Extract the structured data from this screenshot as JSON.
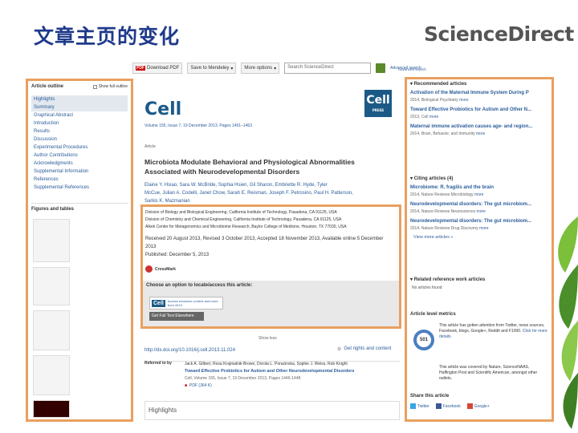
{
  "slide_title": "文章主页的变化",
  "brand": "ScienceDirect",
  "toolbar": {
    "download_pdf": "Download PDF",
    "mendeley": "Save to Mendeley",
    "more_options": "More options",
    "search_placeholder": "Search ScienceDirect",
    "advanced": "Advanced search"
  },
  "outline": {
    "heading": "Article outline",
    "show_full": "Show full outline",
    "items": [
      "Highlights",
      "Summary",
      "Graphical Abstract",
      "Introduction",
      "Results",
      "Discussion",
      "Experimental Procedures",
      "Author Contributions",
      "Acknowledgments",
      "Supplemental Information",
      "References",
      "Supplemental References"
    ],
    "figures_heading": "Figures and tables"
  },
  "article": {
    "journal": "Cell",
    "volume_line": "Volume 155, Issue 7, 19 December 2013, Pages 1451–1463",
    "type": "Article",
    "title": "Microbiota Modulate Behavioral and Physiological Abnormalities Associated with Neurodevelopmental Disorders",
    "authors_1": "Elaine Y. Hsiao, Sara W. McBride, Sophia Hsien, Gil Sharon, Embriette R. Hyde, Tyler",
    "authors_2": "McCue, Julian A. Codelli, Janet Chow, Sarah E. Reisman, Joseph F. Petrosino, Paul H. Patterson,",
    "authors_3": "Sarkis K. Mazmanian",
    "aff_1": "Division of Biology and Biological Engineering, California Institute of Technology, Pasadena, CA 91125, USA",
    "aff_2": "Division of Chemistry and Chemical Engineering, California Institute of Technology, Pasadena, CA 91125, USA",
    "aff_3": "Alkek Center for Metagenomics and Microbiome Research, Baylor College of Medicine, Houston, TX 77030, USA",
    "received": "Received 20 August 2013, Revised 3 October 2013, Accepted 18 November 2013, Available online 5 December 2013",
    "published": "Published: December 5, 2013",
    "crossmark": "CrossMark",
    "access_heading": "Choose an option to locate/access this article:",
    "access_btn": "Get Full Text Elsewhere",
    "access_promo": "Access exclusive content and more from 2013",
    "show_less": "Show less",
    "doi": "http://dx.doi.org/10.1016/j.cell.2013.11.024",
    "rights": "Get rights and content",
    "refereed_label": "Referred to by",
    "refereed_authors": "Jack A. Gilbert, Rosa Krajmalnik-Brown, Dorota L. Porazinska, Sophie J. Weiss, Rob Knight",
    "refereed_title": "Toward Effective Probiotics for Autism and Other Neurodevelopmental Disorders",
    "refereed_meta": "Cell, Volume 155, Issue 7, 19 December 2013, Pages 1446-1448",
    "refereed_pdf": "PDF (364 K)",
    "highlights": "Highlights"
  },
  "sidebar": {
    "recommended_heading": "Recommended articles",
    "recommended": [
      {
        "title": "Activation of the Maternal Immune System During P",
        "meta": "2014, Biological Psychiatry"
      },
      {
        "title": "Toward Effective Probiotics for Autism and Other N...",
        "meta": "2013, Cell"
      },
      {
        "title": "Maternal immune activation causes age- and region...",
        "meta": "2014, Brain, Behavior, and Immunity"
      }
    ],
    "citing_heading": "Citing articles (4)",
    "citing": [
      {
        "title": "Microbiome: R. fragilis and the brain",
        "meta": "2014, Nature Reviews Microbiology"
      },
      {
        "title": "Neurodevelopmental disorders: The gut microbiom...",
        "meta": "2014, Nature Reviews Neuroscience"
      },
      {
        "title": "Neurodevelopmental disorders: The gut microbiom...",
        "meta": "2014, Nature Reviews Drug Discovery"
      }
    ],
    "more_label": "more",
    "view_more": "View more articles »",
    "related_heading": "Related reference work articles",
    "no_articles": "No articles found",
    "metrics_heading": "Article level metrics",
    "altmetric_score": "501",
    "metrics_text_1": "This article has gotten attention from Twitter, news sources, Facebook, blogs, Google+, Reddit and F1000.",
    "metrics_link": "Click for more details.",
    "metrics_text_2": "This article was covered by Nature, ScienceNAAS, Huffington Post and Scientific American, amongst other outlets.",
    "share_heading": "Share this article",
    "twitter": "Twitter",
    "facebook": "Facebook",
    "google": "Google+",
    "advanced_search": "Advanced search"
  }
}
